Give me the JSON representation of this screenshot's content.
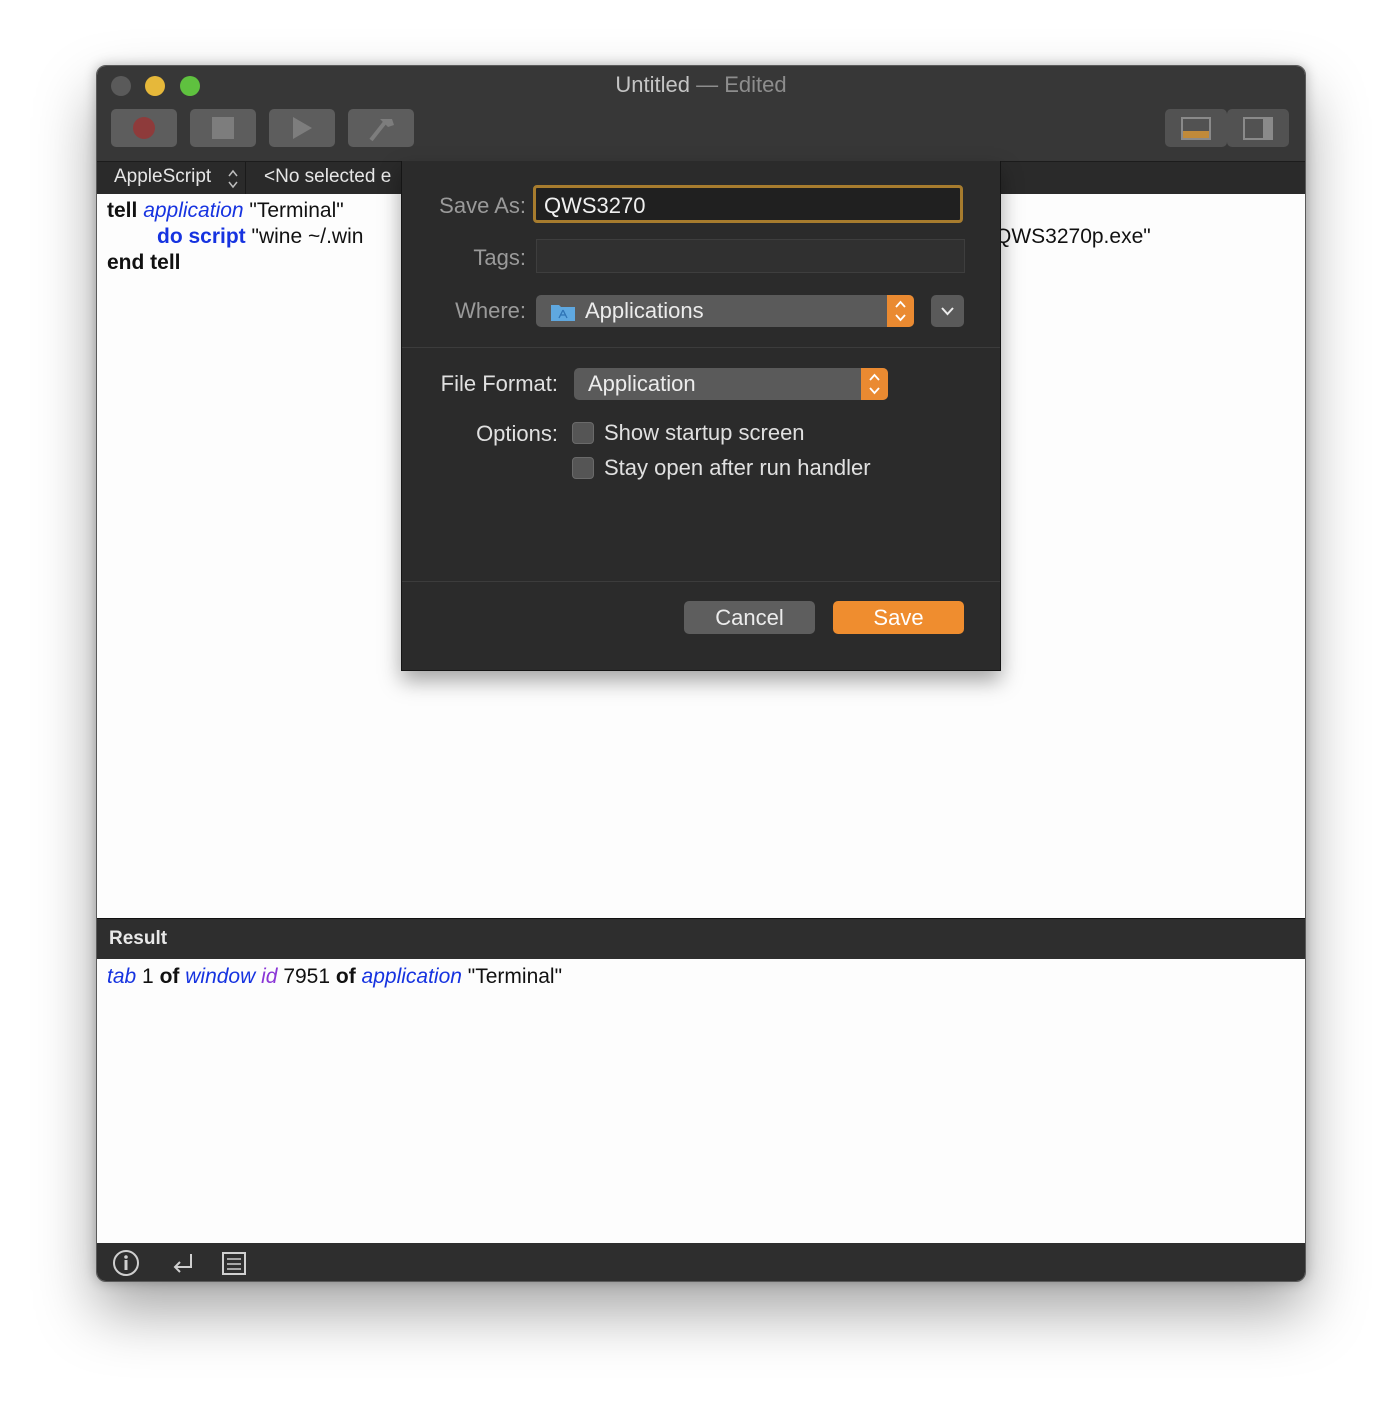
{
  "window": {
    "title": "Untitled",
    "title_sep": " — ",
    "edited": "Edited"
  },
  "toolbar": {
    "record": "record-icon",
    "stop": "stop-icon",
    "run": "run-icon",
    "compile": "hammer-icon",
    "view_bottom": "bottom-panel-icon",
    "view_side": "side-panel-icon"
  },
  "navbar": {
    "language": "AppleScript",
    "element": "<No selected e"
  },
  "script": {
    "line1": {
      "kw1": "tell",
      "app": "application",
      "str": " \"Terminal\""
    },
    "line2": {
      "cmd": "do script",
      "str_start": " \"wine ~/.win",
      "str_end": "QWS3270p.exe\""
    },
    "line3": {
      "kw": "end tell"
    }
  },
  "result": {
    "label": "Result",
    "tab": "tab",
    "n1": " 1 ",
    "of1": "of",
    "window": "window",
    "id": "id",
    "n2": " 7951 ",
    "of2": "of",
    "application": "application",
    "terminal": " \"Terminal\""
  },
  "sheet": {
    "save_as_label": "Save As:",
    "save_as_value": "QWS3270",
    "tags_label": "Tags:",
    "where_label": "Where:",
    "where_value": "Applications",
    "file_format_label": "File Format:",
    "file_format_value": "Application",
    "options_label": "Options:",
    "option1": "Show startup screen",
    "option2": "Stay open after run handler",
    "option1_checked": false,
    "option2_checked": false,
    "cancel": "Cancel",
    "save": "Save"
  },
  "colors": {
    "accent": "#ef8d2f",
    "keyword_blue": "#1633e0",
    "id_purple": "#8a35d6"
  }
}
